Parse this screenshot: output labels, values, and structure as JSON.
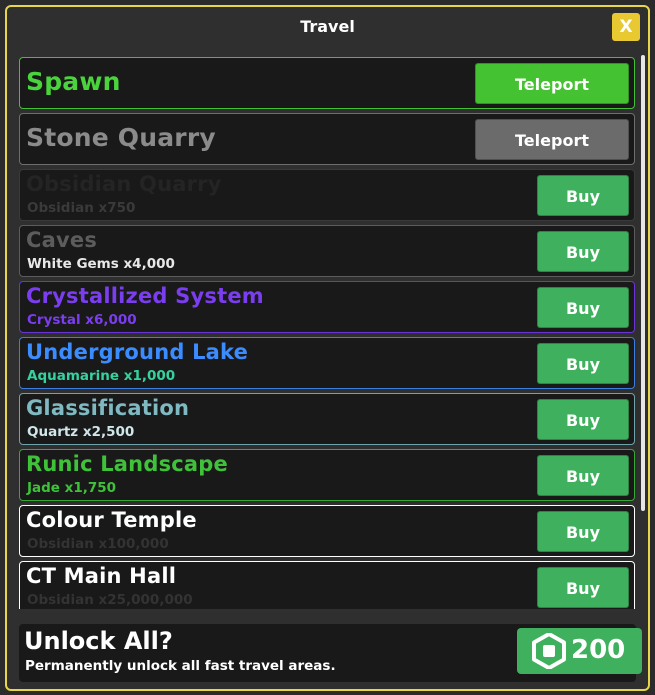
{
  "window": {
    "title": "Travel",
    "close_label": "X"
  },
  "locations": [
    {
      "name": "Spawn",
      "cost": "",
      "action": "Teleport",
      "name_color": "#4ad43c",
      "border_color": "#45c036",
      "button_color": "#45c232"
    },
    {
      "name": "Stone Quarry",
      "cost": "",
      "action": "Teleport",
      "name_color": "#8b8b8b",
      "border_color": "#6e6e6e",
      "button_color": "#6b6b6b"
    },
    {
      "name": "Obsidian Quarry",
      "cost": "Obsidian x750",
      "action": "Buy",
      "name_color": "#242424",
      "cost_color": "#3a3a3a",
      "border_color": "#3a3a3a"
    },
    {
      "name": "Caves",
      "cost": "White Gems x4,000",
      "action": "Buy",
      "name_color": "#5c5c5c",
      "cost_color": "#e8e8e8",
      "border_color": "#5c5c5c"
    },
    {
      "name": "Crystallized System",
      "cost": "Crystal x6,000",
      "action": "Buy",
      "name_color": "#7b3df0",
      "cost_color": "#7b3df0",
      "border_color": "#6a35d8"
    },
    {
      "name": "Underground Lake",
      "cost": "Aquamarine x1,000",
      "action": "Buy",
      "name_color": "#3b8cff",
      "cost_color": "#35d2a0",
      "border_color": "#3b7de0"
    },
    {
      "name": "Glassification",
      "cost": "Quartz x2,500",
      "action": "Buy",
      "name_color": "#7fbac2",
      "cost_color": "#cfe6ea",
      "border_color": "#6fa3ab"
    },
    {
      "name": "Runic Landscape",
      "cost": "Jade x1,750",
      "action": "Buy",
      "name_color": "#3fc23a",
      "cost_color": "#3fc23a",
      "border_color": "#38a834"
    },
    {
      "name": "Colour Temple",
      "cost": "Obsidian x100,000",
      "action": "Buy",
      "name_color": "#ffffff",
      "cost_color": "#333333",
      "border_color": "#ffffff"
    },
    {
      "name": "CT Main Hall",
      "cost": "Obsidian x25,000,000",
      "action": "Buy",
      "name_color": "#ffffff",
      "cost_color": "#333333",
      "border_color": "#ffffff"
    }
  ],
  "unlock_all": {
    "title": "Unlock All?",
    "subtitle": "Permanently unlock all fast travel areas.",
    "price": "200",
    "icon": "robux-icon"
  }
}
